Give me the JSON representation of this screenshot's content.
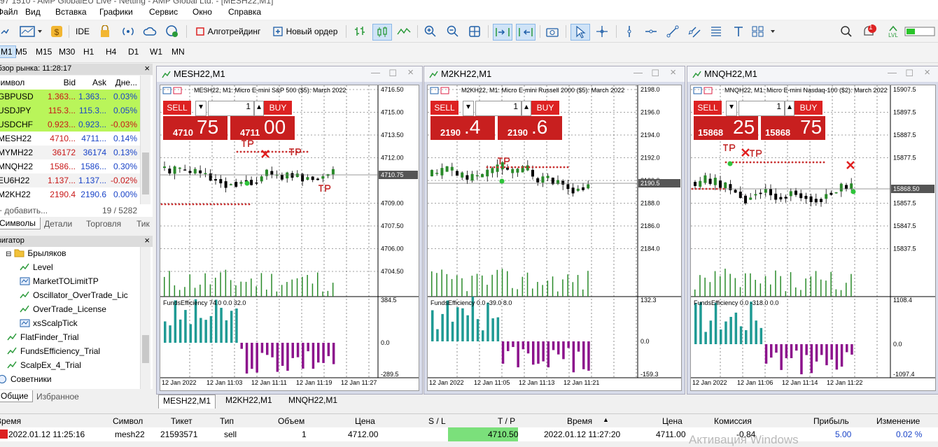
{
  "window": {
    "title_partial": "97 1510 - AMP GlobalEU Live - Netting - AMP Global Ltd. - [MESH22,M1]"
  },
  "menu": [
    "Файл",
    "Вид",
    "Вставка",
    "Графики",
    "Сервис",
    "Окно",
    "Справка"
  ],
  "toolbar": {
    "ide": "IDE",
    "algo": "Алготрейдинг",
    "new_order": "Новый ордер",
    "notification_count": "1",
    "lvl": "LVL"
  },
  "timeframes": [
    "M1",
    "M5",
    "M15",
    "M30",
    "H1",
    "H4",
    "D1",
    "W1",
    "MN"
  ],
  "market_watch": {
    "header": "Обзор рынка: 11:28:17",
    "columns": {
      "symbol": "Символ",
      "bid": "Bid",
      "ask": "Ask",
      "change": "Дне..."
    },
    "rows": [
      {
        "symbol": "GBPUSD",
        "bid": "1.363...",
        "ask": "1.363...",
        "change": "0.03%",
        "bg": "#b9f55a"
      },
      {
        "symbol": "USDJPY",
        "bid": "115.3...",
        "ask": "115.3...",
        "change": "0.05%",
        "bg": "#b9f55a"
      },
      {
        "symbol": "USDCHF",
        "bid": "0.923...",
        "ask": "0.923...",
        "change": "-0.03%",
        "bg": "#b9f55a"
      },
      {
        "symbol": "MESH22",
        "bid": "4710...",
        "ask": "4711...",
        "change": "0.14%",
        "bg": "#ffffff"
      },
      {
        "symbol": "MYMH22",
        "bid": "36172",
        "ask": "36174",
        "change": "0.13%",
        "bg": "#f2f2f2"
      },
      {
        "symbol": "MNQH22",
        "bid": "1586...",
        "ask": "1586...",
        "change": "0.30%",
        "bg": "#ffffff"
      },
      {
        "symbol": "EU6H22",
        "bid": "1.137...",
        "ask": "1.137...",
        "change": "-0.02%",
        "bg": "#f2f2f2"
      },
      {
        "symbol": "M2KH22",
        "bid": "2190.4",
        "ask": "2190.6",
        "change": "0.00%",
        "bg": "#ffffff"
      }
    ],
    "add_label": "+ добавить...",
    "count": "19 / 5282",
    "tabs": [
      "Символы",
      "Детали",
      "Торговля",
      "Тик"
    ]
  },
  "navigator": {
    "header": "Навигатор",
    "items": [
      {
        "label": "Брыляков",
        "level": 1,
        "icon": "folder-icon"
      },
      {
        "label": "Level",
        "level": 2,
        "icon": "indicator-icon"
      },
      {
        "label": "MarketTOLimitTP",
        "level": 2,
        "icon": "script-icon"
      },
      {
        "label": "Oscillator_OverTrade_Lic",
        "level": 2,
        "icon": "indicator-icon"
      },
      {
        "label": "OverTrade_License",
        "level": 2,
        "icon": "indicator-icon"
      },
      {
        "label": "xsScalpTick",
        "level": 2,
        "icon": "script-icon"
      },
      {
        "label": "FlatFinder_Trial",
        "level": 1,
        "icon": "indicator-icon"
      },
      {
        "label": "FundsEfficiency_Trial",
        "level": 1,
        "icon": "indicator-icon"
      },
      {
        "label": "ScalpEx_4_Trial",
        "level": 1,
        "icon": "indicator-icon"
      },
      {
        "label": "Советники",
        "level": 0,
        "icon": "expert-icon"
      }
    ],
    "tabs": [
      "Общие",
      "Избранное"
    ]
  },
  "charts": [
    {
      "window_title": "MESH22,M1",
      "info": "MESH22, M1:  Micro E-mini S&P 500 ($5): March 2022",
      "sell": "SELL",
      "buy": "BUY",
      "lot": "1",
      "sell_small": "4710",
      "sell_big": "75",
      "buy_small": "4711",
      "buy_big": "00",
      "price_labels": [
        "4716.50",
        "4715.00",
        "4713.50",
        "4712.00",
        "4709.00",
        "4707.50",
        "4706.00",
        "4704.50"
      ],
      "current_price": "4710.75",
      "ind_title": "FundsEfficiency 74.0 0.0 32.0",
      "ind_labels": [
        "384.5",
        "0.0",
        "-289.5"
      ],
      "time_labels": [
        "12 Jan 2022",
        "12 Jan 11:03",
        "12 Jan 11:11",
        "12 Jan 11:19",
        "12 Jan 11:27"
      ]
    },
    {
      "window_title": "M2KH22,M1",
      "info": "M2KH22, M1:  Micro E-mini Russell 2000 ($5): March 2022",
      "sell": "SELL",
      "buy": "BUY",
      "lot": "1",
      "sell_small": "2190",
      "sell_big": ".4",
      "buy_small": "2190",
      "buy_big": ".6",
      "price_labels": [
        "2198.0",
        "2196.0",
        "2194.0",
        "2192.0",
        "2190.0",
        "2188.0",
        "2186.0",
        "2184.0"
      ],
      "current_price": "2190.5",
      "ind_title": "FundsEfficiency 0.0 -39.0 8.0",
      "ind_labels": [
        "132.3",
        "0.0",
        "-159.3"
      ],
      "time_labels": [
        "12 Jan 2022",
        "12 Jan 11:05",
        "12 Jan 11:13",
        "12 Jan 11:21"
      ]
    },
    {
      "window_title": "MNQH22,M1",
      "info": "MNQH22, M1:  Micro E-mini Nasdaq-100 ($2): March 2022",
      "sell": "SELL",
      "buy": "BUY",
      "lot": "1",
      "sell_small": "15868",
      "sell_big": "25",
      "buy_small": "15868",
      "buy_big": "75",
      "price_labels": [
        "15907.5",
        "15897.5",
        "15887.5",
        "15877.5",
        "15857.5",
        "15847.5",
        "15837.5"
      ],
      "current_price": "15868.50",
      "ind_title": "FundsEfficiency 0.0 -318.0 0.0",
      "ind_labels": [
        "1108.4",
        "0.0",
        "-1097.4"
      ],
      "time_labels": [
        "12 Jan 2022",
        "12 Jan 11:06",
        "12 Jan 11:14",
        "12 Jan 11:22"
      ]
    }
  ],
  "chart_tabs": [
    "MESH22,M1",
    "M2KH22,M1",
    "MNQH22,M1"
  ],
  "trades": {
    "columns": [
      "Время",
      "Символ",
      "Тикет",
      "Тип",
      "Объем",
      "Цена",
      "S / L",
      "T / P",
      "Время",
      "Цена",
      "Комиссия",
      "Прибыль",
      "Изменение"
    ],
    "row": [
      "2022.01.12 11:25:16",
      "mesh22",
      "21593571",
      "sell",
      "1",
      "4712.00",
      "",
      "4710.50",
      "2022.01.12 11:27:20",
      "4711.00",
      "-0.84",
      "5.00",
      "0.02 %"
    ]
  },
  "watermark": "Активация Windows"
}
